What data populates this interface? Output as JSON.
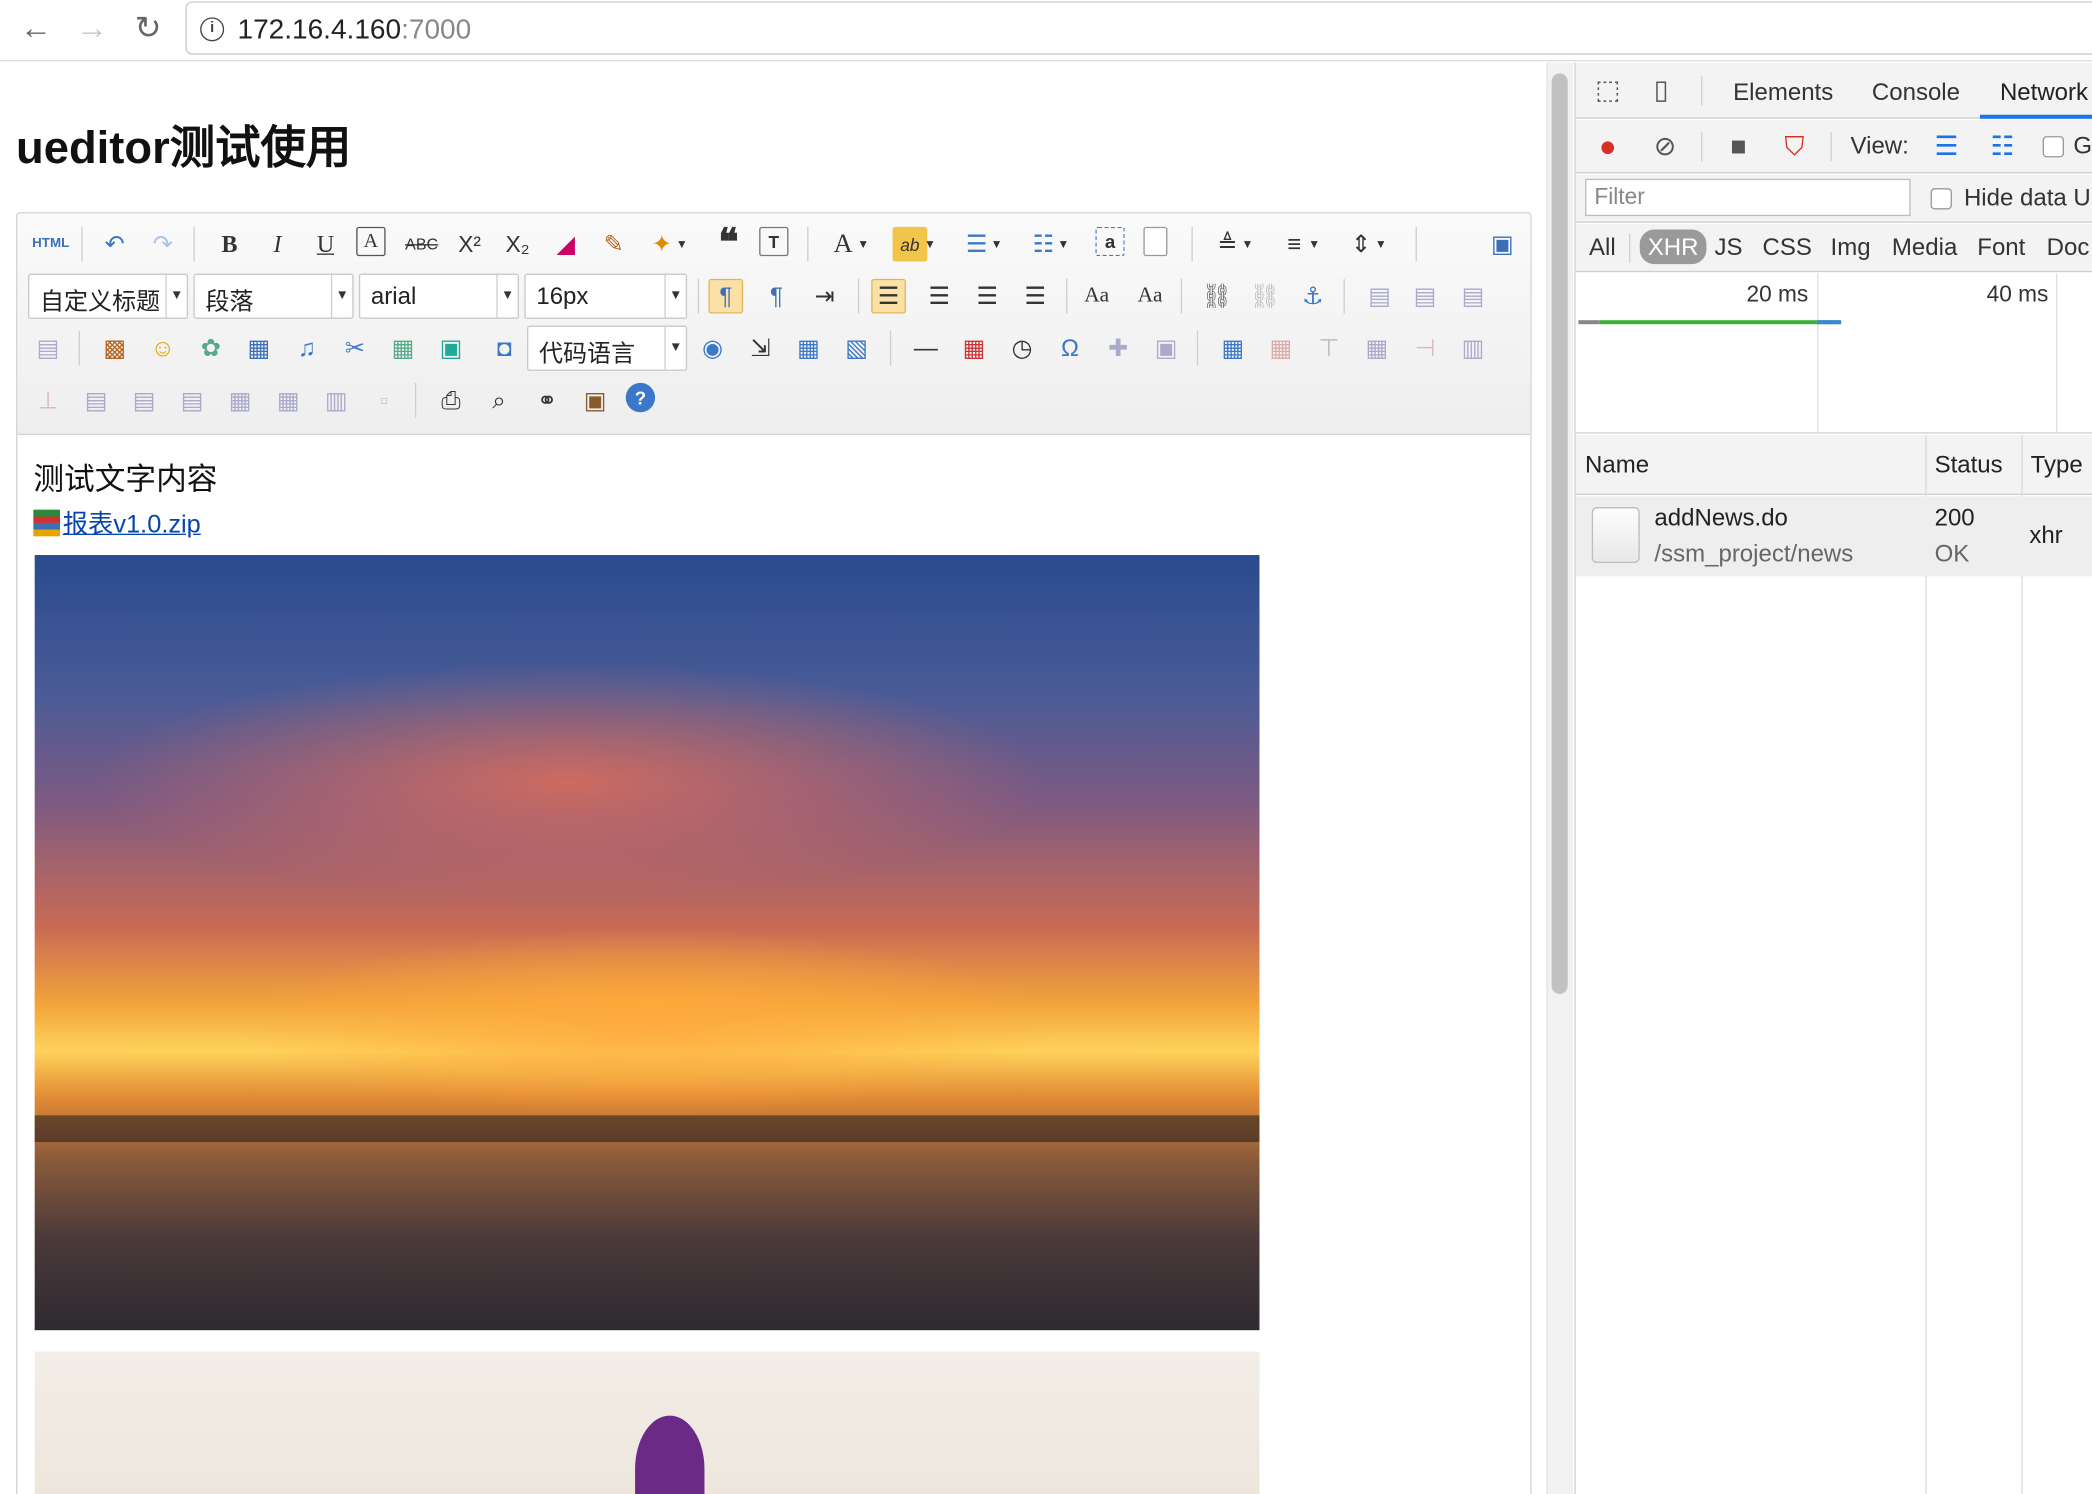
{
  "browser": {
    "back_icon": "←",
    "forward_icon": "→",
    "reload_icon": "↻",
    "info_icon": "i",
    "url_host": "172.16.4.160",
    "url_port": ":7000"
  },
  "page": {
    "title": "ueditor测试使用"
  },
  "editor": {
    "combos": {
      "custom_heading": "自定义标题",
      "paragraph": "段落",
      "font_family": "arial",
      "font_size": "16px",
      "code_language": "代码语言"
    },
    "content": {
      "text": "测试文字内容",
      "attachment_link": "报表v1.0.zip"
    }
  },
  "devtools": {
    "tabs": [
      "Elements",
      "Console",
      "Network"
    ],
    "view_label": "View:",
    "filter_placeholder": "Filter",
    "hide_data_label": "Hide data U",
    "g_label": "G",
    "type_filters": [
      "All",
      "XHR",
      "JS",
      "CSS",
      "Img",
      "Media",
      "Font",
      "Doc"
    ],
    "timeline_labels": [
      "20 ms",
      "40 ms"
    ],
    "columns": [
      "Name",
      "Status",
      "Type"
    ],
    "requests": [
      {
        "name": "addNews.do",
        "path": "/ssm_project/news",
        "status": "200",
        "status_text": "OK",
        "type": "xhr"
      }
    ],
    "accent_color": "#1a73e8"
  }
}
